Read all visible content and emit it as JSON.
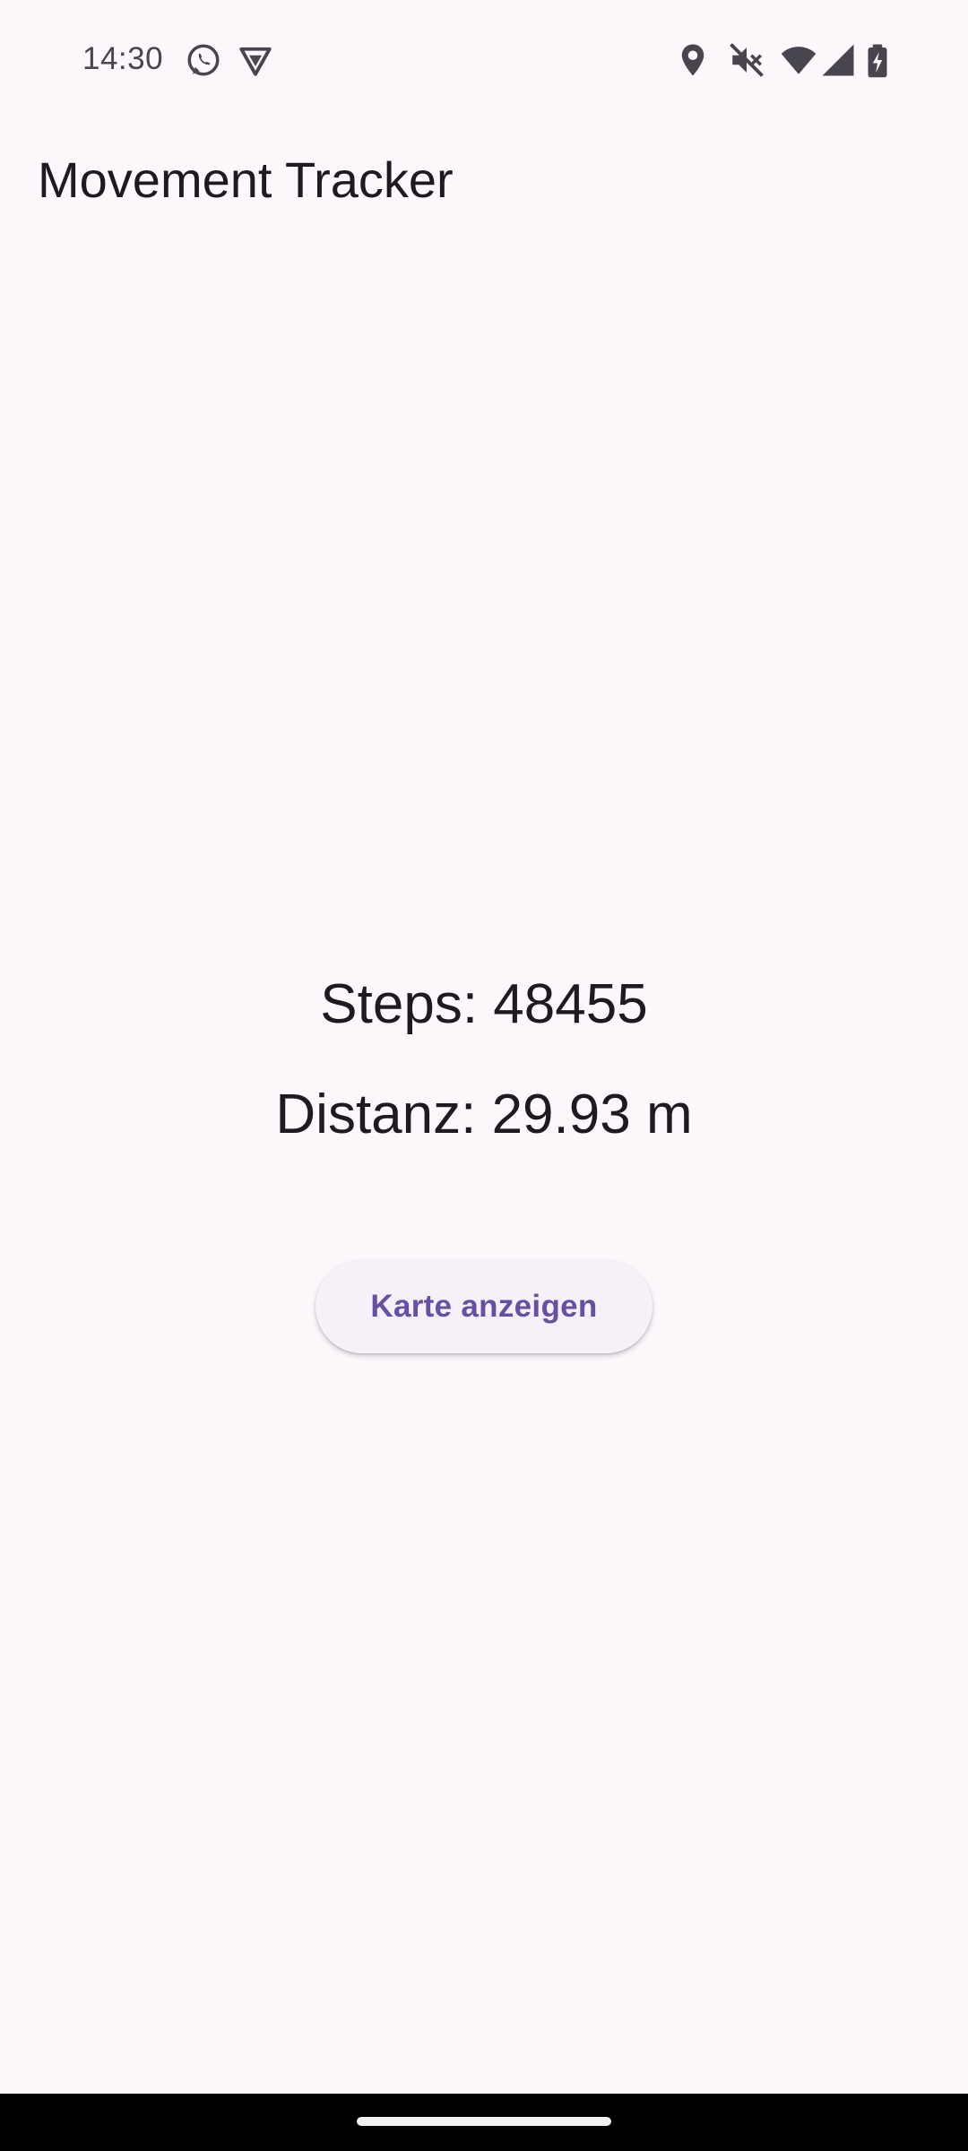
{
  "status_bar": {
    "time": "14:30",
    "left_icons": [
      "whatsapp-icon",
      "vpn-shield-icon"
    ],
    "right_icons": [
      "location-icon",
      "mute-icon",
      "wifi-icon",
      "cell-signal-icon",
      "battery-charging-icon"
    ]
  },
  "app_bar": {
    "title": "Movement Tracker"
  },
  "main": {
    "steps_text": "Steps: 48455",
    "distance_text": "Distanz: 29.93 m",
    "map_button_label": "Karte anzeigen"
  },
  "colors": {
    "background": "#fdf7fc",
    "accent": "#6750a4",
    "text": "#1d1b20"
  }
}
